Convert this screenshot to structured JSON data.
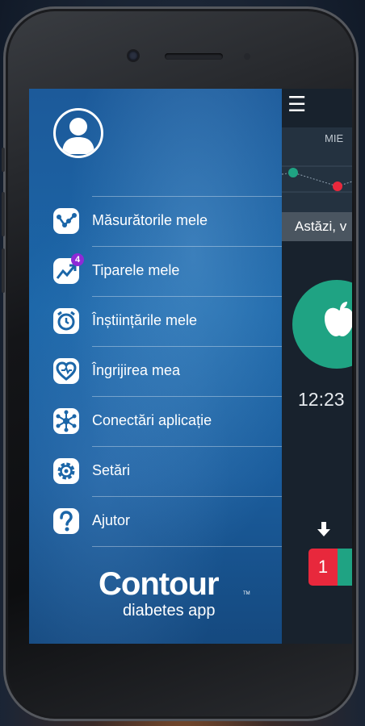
{
  "app": {
    "menu_glyph": "☰",
    "day_label": "MIE",
    "today_label": "Astăzi, v",
    "time_label": "12:23",
    "apple_glyph": "",
    "down_glyph": "🡇",
    "result_value": "1",
    "colors": {
      "green": "#1fa383",
      "red": "#e8283c"
    }
  },
  "drawer": {
    "menu": [
      {
        "label": "Măsurătorile mele",
        "icon": "chart-nodes-icon"
      },
      {
        "label": "Tiparele mele",
        "icon": "trend-up-icon",
        "badge": "4"
      },
      {
        "label": "Înștiințările mele",
        "icon": "alarm-clock-icon"
      },
      {
        "label": "Îngrijirea mea",
        "icon": "heart-care-icon"
      },
      {
        "label": "Conectări aplicație",
        "icon": "connections-icon"
      },
      {
        "label": "Setări",
        "icon": "gear-icon"
      },
      {
        "label": "Ajutor",
        "icon": "help-icon"
      }
    ],
    "brand": {
      "name": "Contour",
      "tm": "TM",
      "sub": "diabetes app"
    },
    "colors": {
      "drawer_blue": "#1b66a8",
      "badge_purple": "#8e2ad6"
    }
  }
}
